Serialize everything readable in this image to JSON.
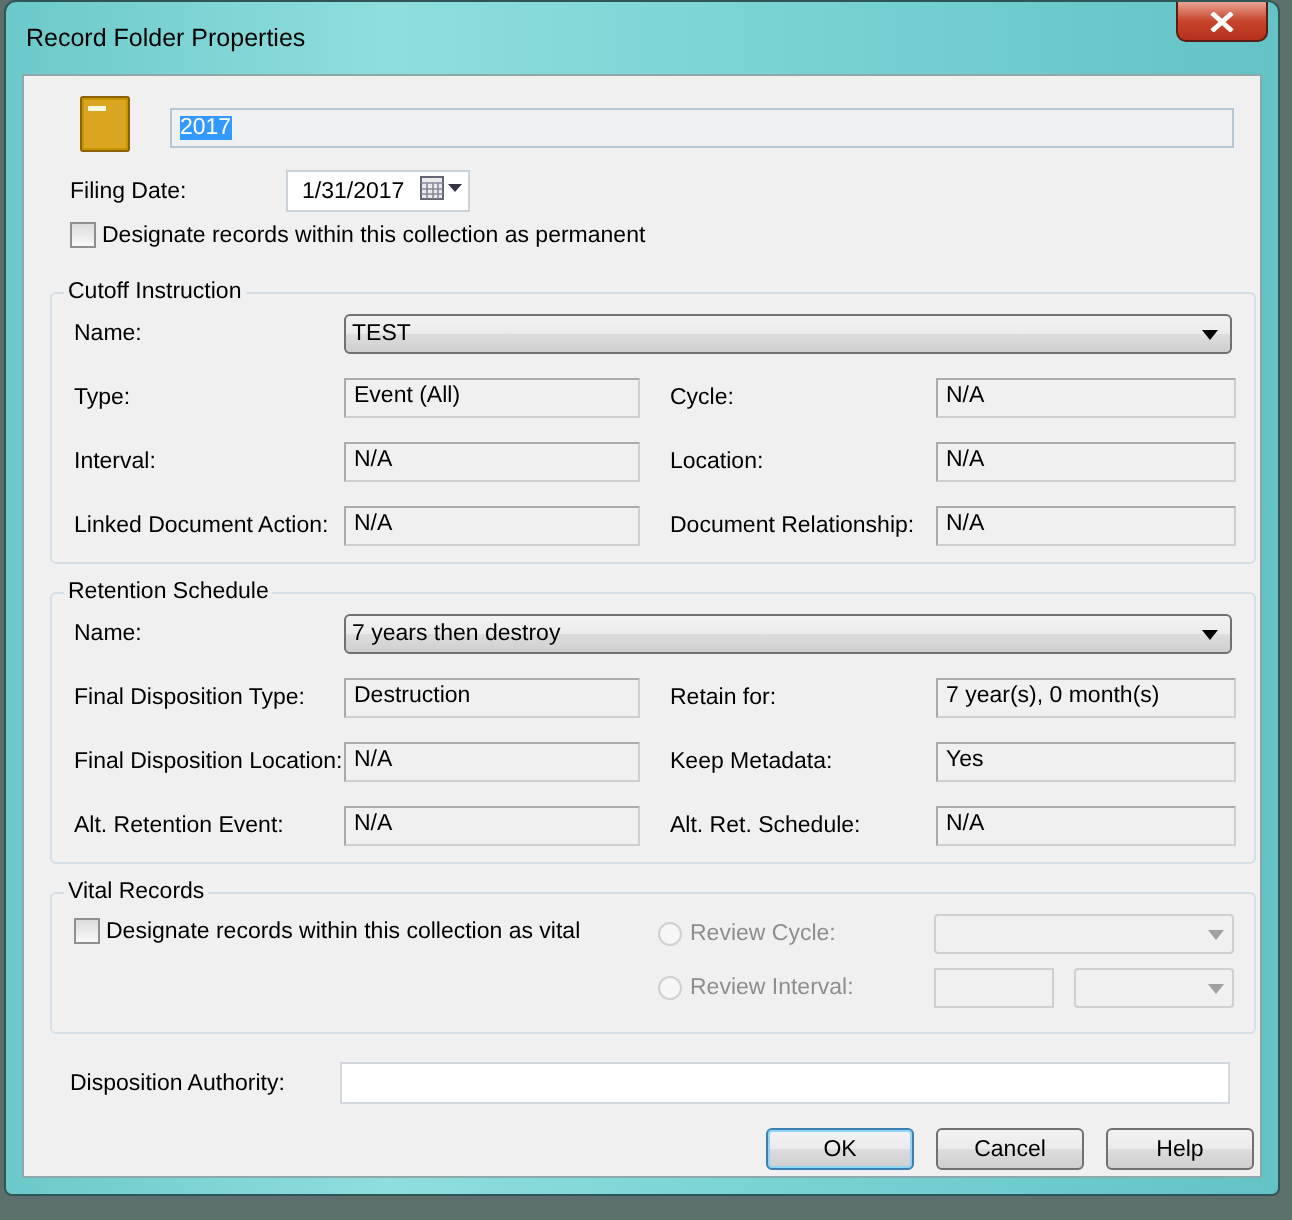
{
  "window": {
    "title": "Record Folder Properties"
  },
  "name_field": {
    "value": "2017",
    "selected": true
  },
  "filing_date": {
    "label": "Filing Date:",
    "value": "1/31/2017"
  },
  "permanent": {
    "label": "Designate records within this collection as permanent",
    "checked": false
  },
  "cutoff_instruction": {
    "title": "Cutoff Instruction",
    "name": {
      "label": "Name:",
      "value": "TEST"
    },
    "fields": [
      {
        "label": "Type:",
        "value": "Event (All)"
      },
      {
        "label": "Cycle:",
        "value": "N/A"
      },
      {
        "label": "Interval:",
        "value": "N/A"
      },
      {
        "label": "Location:",
        "value": "N/A"
      },
      {
        "label": "Linked Document Action:",
        "value": "N/A"
      },
      {
        "label": "Document Relationship:",
        "value": "N/A"
      }
    ]
  },
  "retention_schedule": {
    "title": "Retention Schedule",
    "name": {
      "label": "Name:",
      "value": "7 years then destroy"
    },
    "fields": [
      {
        "label": "Final Disposition Type:",
        "value": "Destruction"
      },
      {
        "label": "Retain for:",
        "value": "7 year(s), 0 month(s)"
      },
      {
        "label": "Final Disposition Location:",
        "value": "N/A"
      },
      {
        "label": "Keep Metadata:",
        "value": "Yes"
      },
      {
        "label": "Alt. Retention Event:",
        "value": "N/A"
      },
      {
        "label": "Alt. Ret. Schedule:",
        "value": "N/A"
      }
    ]
  },
  "vital_records": {
    "title": "Vital Records",
    "vital": {
      "label": "Designate records within this collection as vital",
      "checked": false
    },
    "options": [
      {
        "label": "Review Cycle:",
        "kind": "dropdown",
        "selected": false,
        "disabled": true
      },
      {
        "label": "Review Interval:",
        "kind": "number-dropdown",
        "selected": false,
        "disabled": true
      }
    ]
  },
  "disposition_authority": {
    "label": "Disposition Authority:"
  },
  "buttons": [
    {
      "label": "OK",
      "default": true
    },
    {
      "label": "Cancel",
      "default": false
    },
    {
      "label": "Help",
      "default": false
    }
  ]
}
